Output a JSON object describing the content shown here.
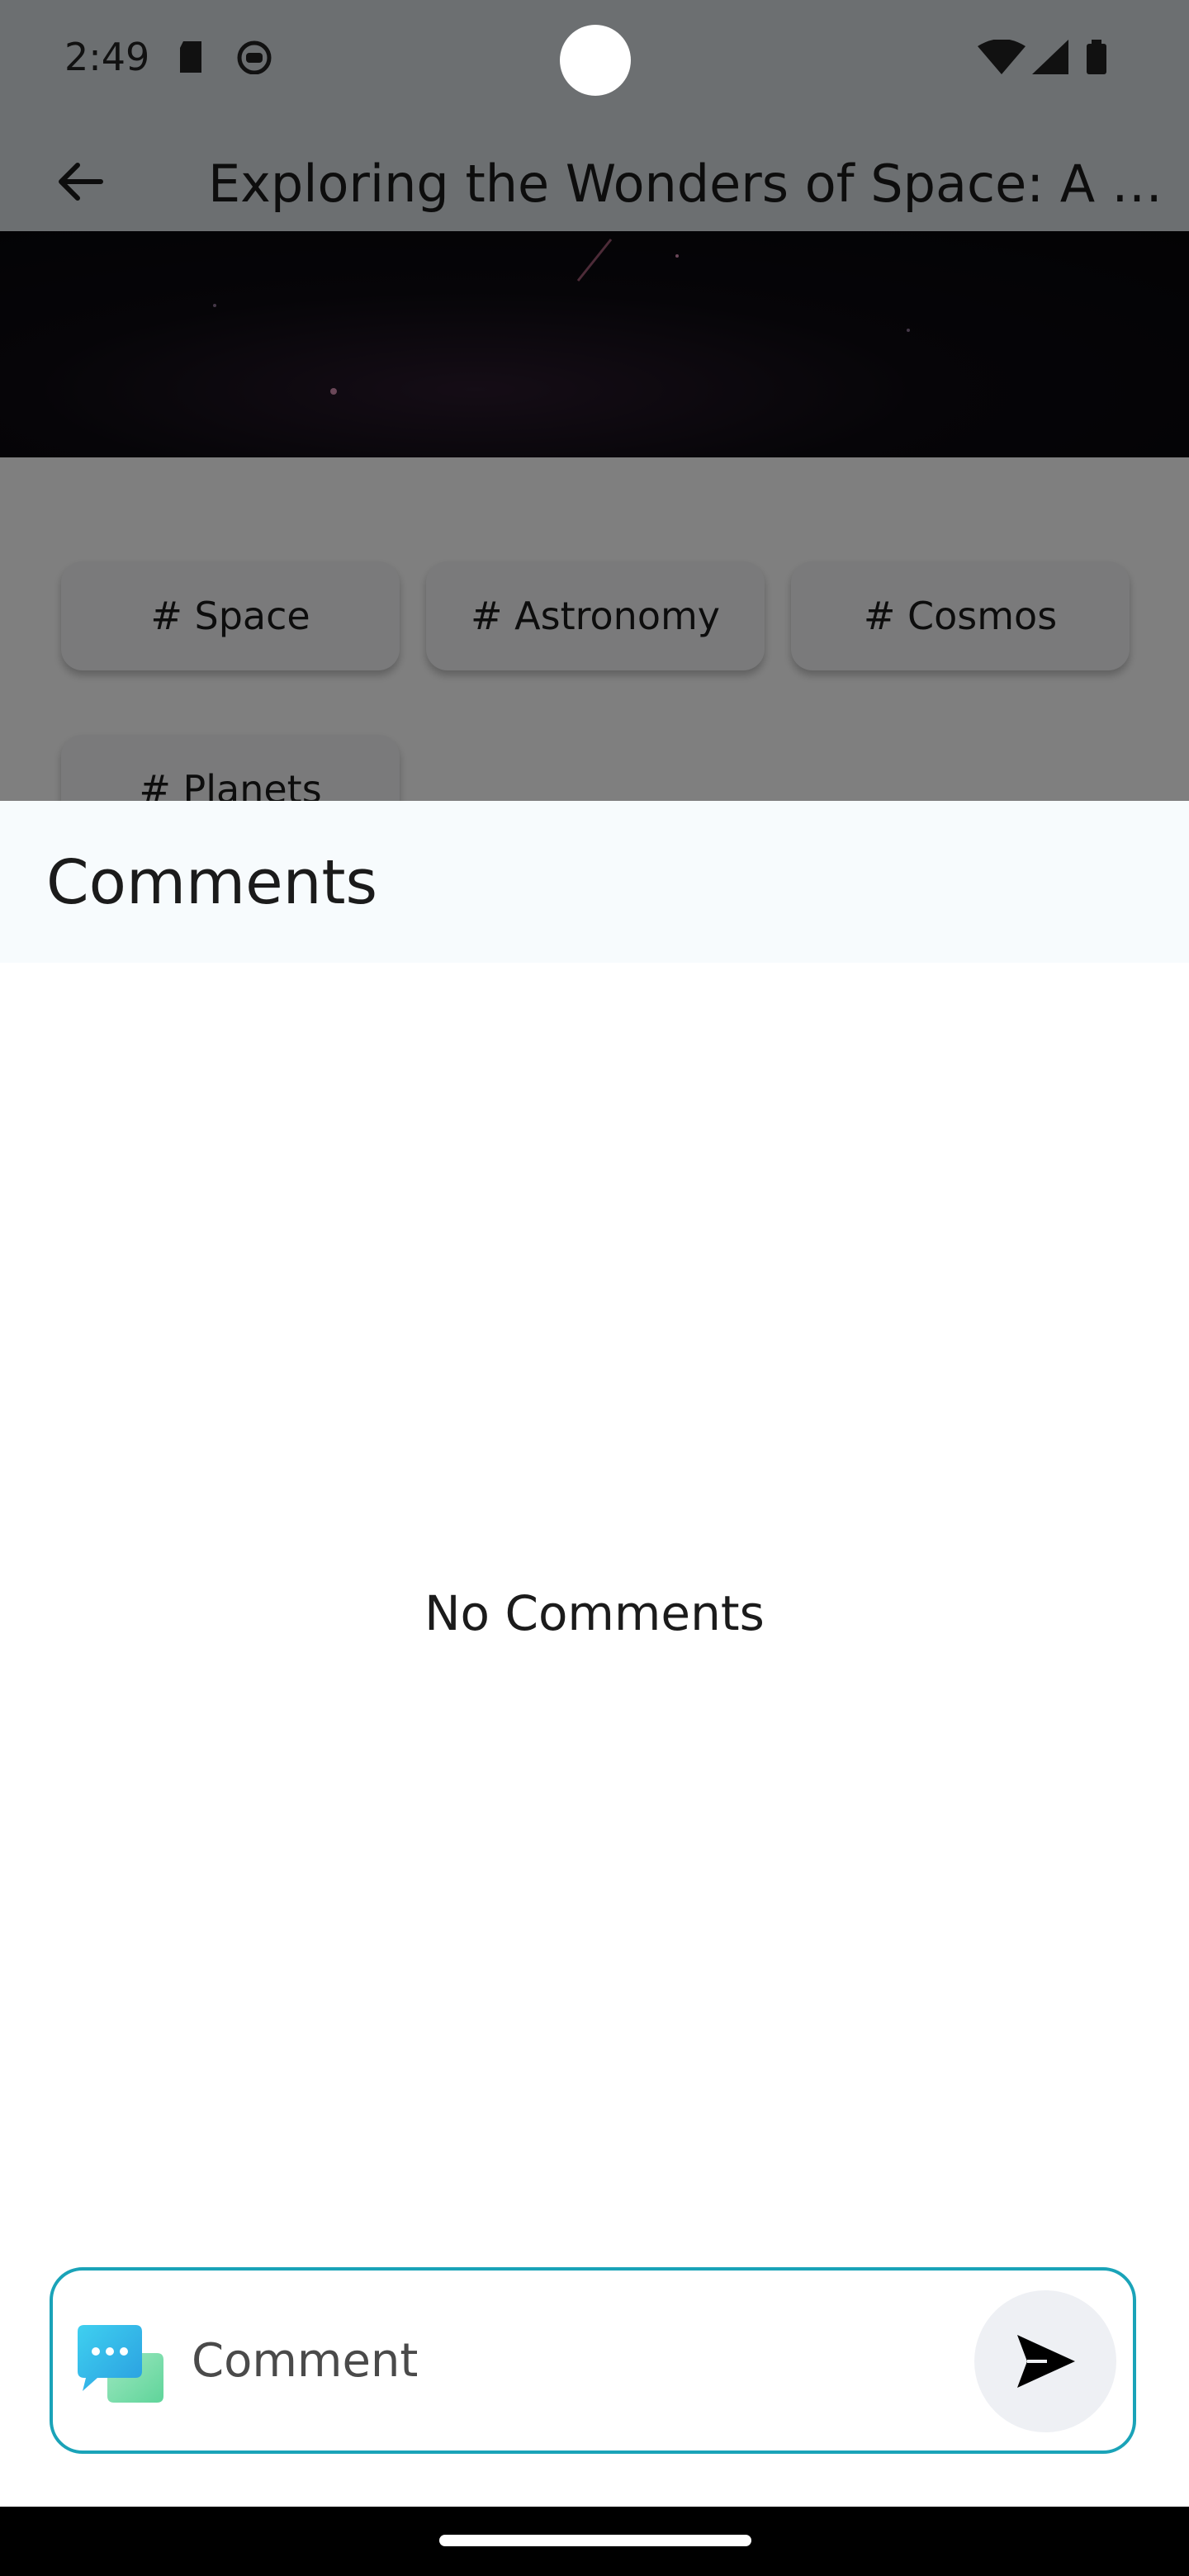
{
  "status_bar": {
    "time": "2:49",
    "icons": [
      "sd-card-icon",
      "android-debug-icon",
      "wifi-icon",
      "cellular-signal-icon",
      "battery-icon"
    ]
  },
  "app_bar": {
    "title": "Exploring the Wonders of Space: A Journey Through the Cosmos",
    "back_icon": "arrow-back-icon"
  },
  "tags": [
    {
      "label": "# Space"
    },
    {
      "label": "# Astronomy"
    },
    {
      "label": "# Cosmos"
    },
    {
      "label": "# Planets"
    }
  ],
  "comments_sheet": {
    "title": "Comments",
    "empty_message": "No Comments",
    "input": {
      "placeholder": "Comment",
      "value": ""
    },
    "send_icon": "send-icon",
    "chat_icon": "chat-bubbles-icon"
  },
  "colors": {
    "accent": "#1aa3b8",
    "scrim": "#000000",
    "sheet_header": "#f7fbfd"
  }
}
